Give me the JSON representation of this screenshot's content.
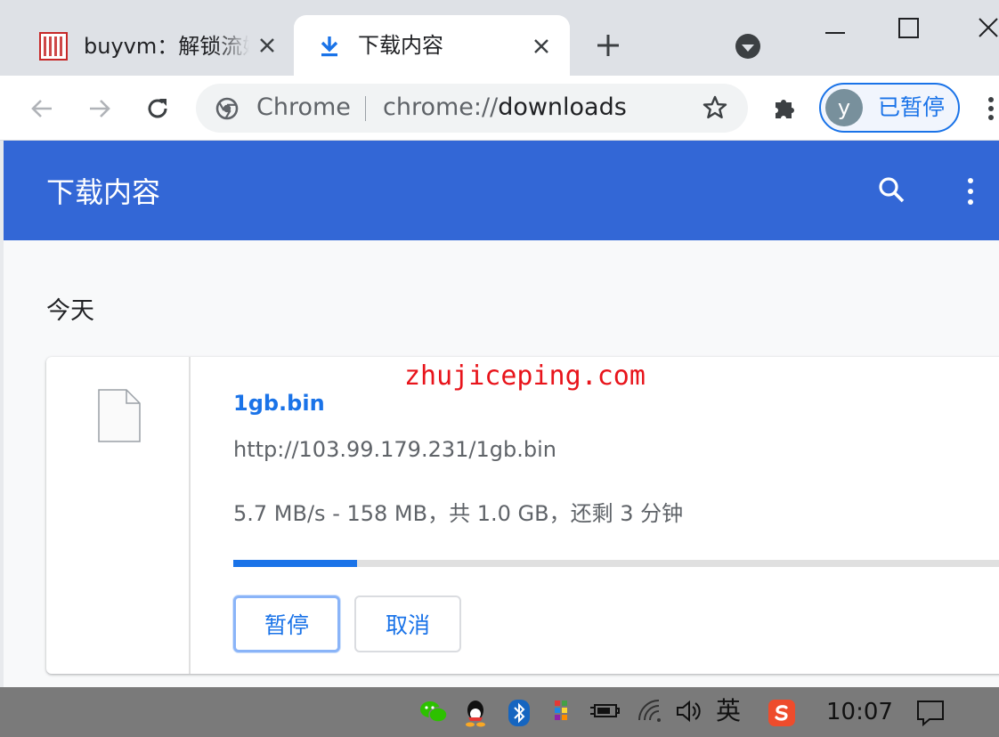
{
  "tabs": [
    {
      "title": "buyvm：解锁流媒体",
      "active": false
    },
    {
      "title": "下载内容",
      "active": true
    }
  ],
  "toolbar": {
    "omnibox_scheme": "Chrome",
    "omnibox_url_prefix": "chrome://",
    "omnibox_url_path": "downloads",
    "profile_initial": "y",
    "profile_status": "已暂停"
  },
  "downloads": {
    "page_title": "下载内容",
    "section_date": "今天",
    "items": [
      {
        "filename": "1gb.bin",
        "url": "http://103.99.179.231/1gb.bin",
        "status": "5.7 MB/s - 158 MB，共 1.0 GB，还剩 3 分钟",
        "progress": 0.158,
        "pause_label": "暂停",
        "cancel_label": "取消"
      }
    ]
  },
  "watermark": "zhujiceping.com",
  "taskbar": {
    "language": "英",
    "time": "10:07"
  },
  "colors": {
    "header_blue": "#3367d6",
    "link_blue": "#1a73e8",
    "watermark_red": "#e8141b"
  }
}
